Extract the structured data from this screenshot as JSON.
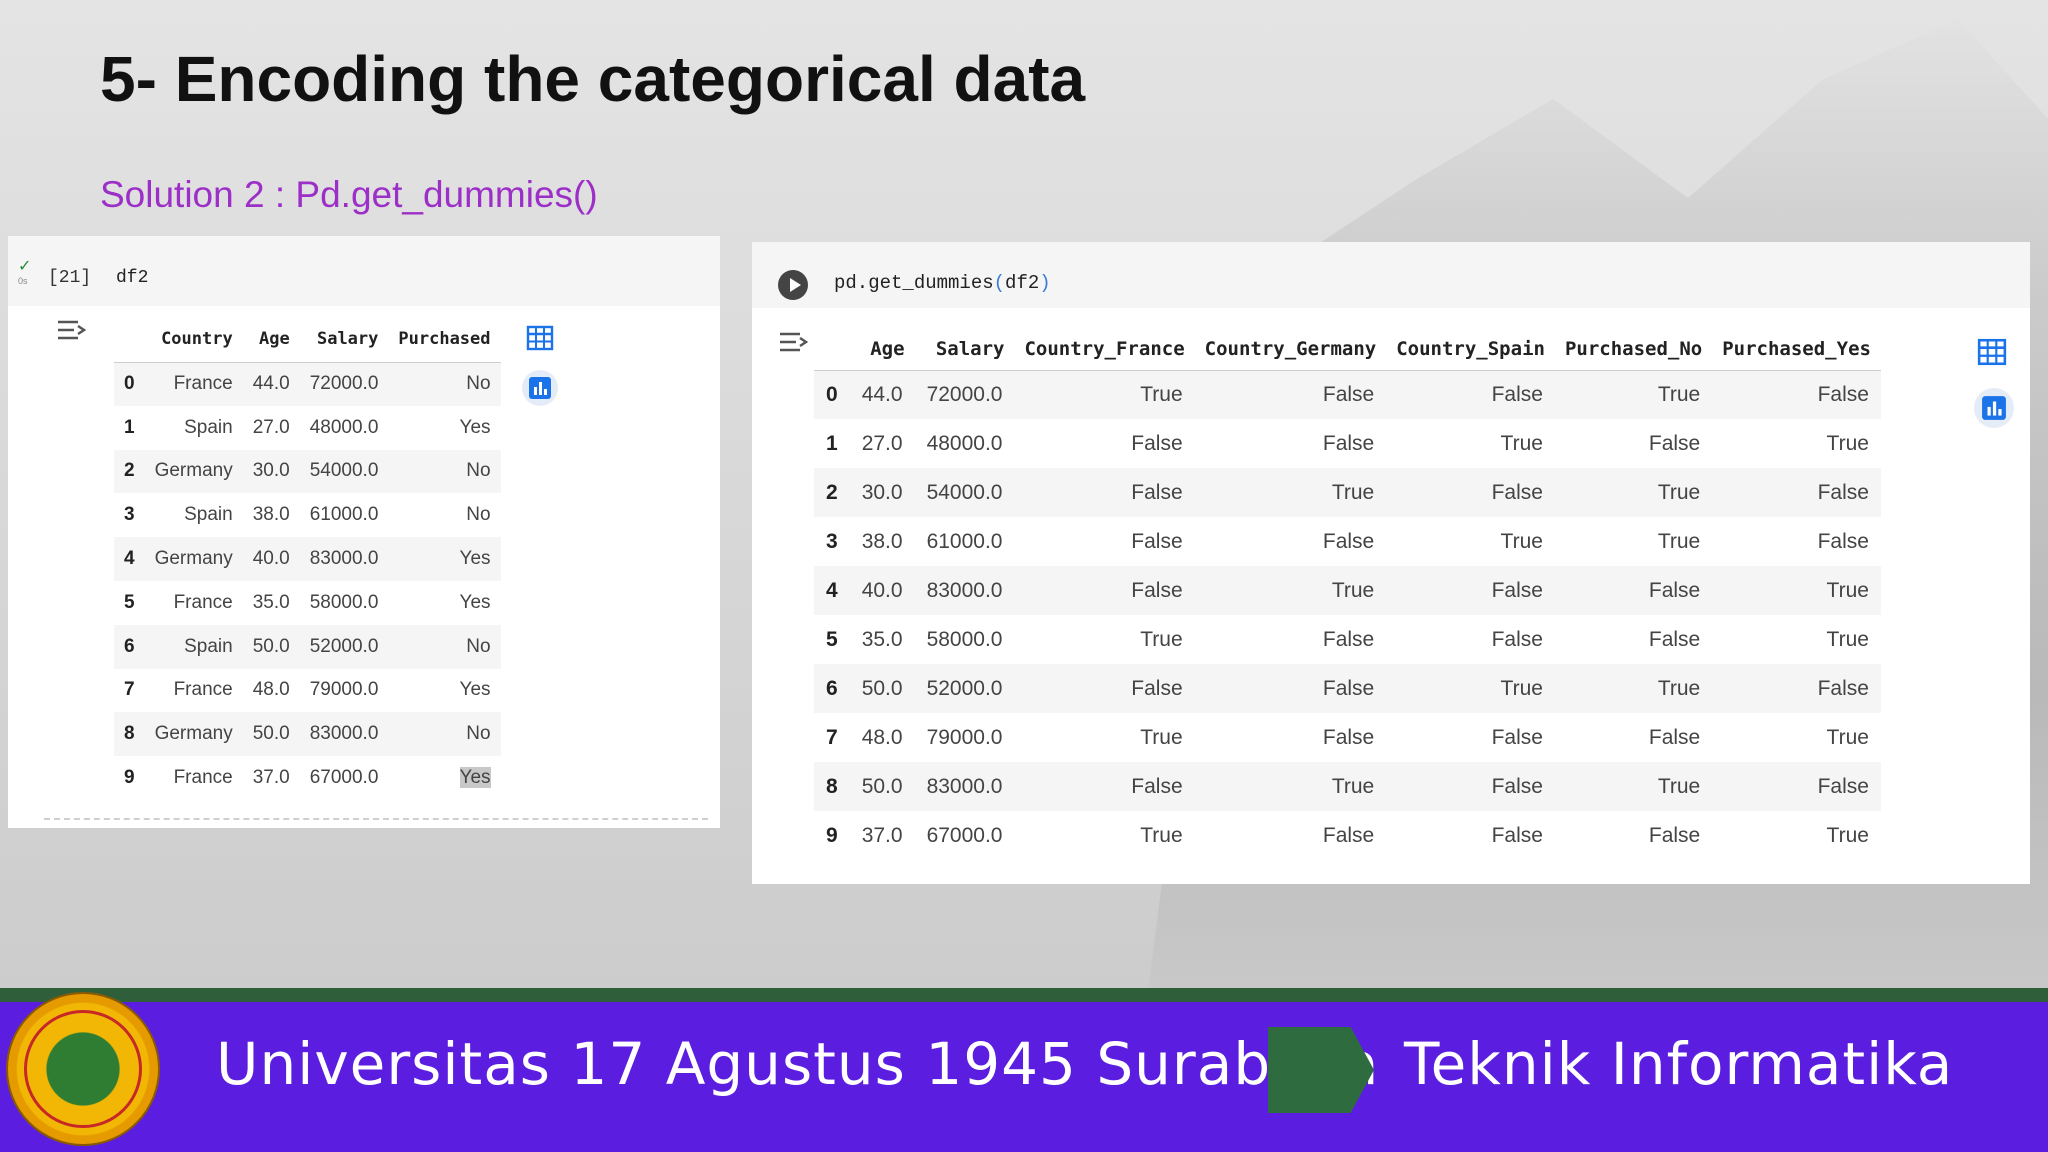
{
  "slide": {
    "title": "5- Encoding the categorical data",
    "subtitle": "Solution 2 : Pd.get_dummies()"
  },
  "left_cell": {
    "exec_status": "✓",
    "exec_time": "0s",
    "exec_count": "[21]",
    "code": "df2",
    "columns": [
      "Country",
      "Age",
      "Salary",
      "Purchased"
    ],
    "rows": [
      {
        "idx": "0",
        "cells": [
          "France",
          "44.0",
          "72000.0",
          "No"
        ]
      },
      {
        "idx": "1",
        "cells": [
          "Spain",
          "27.0",
          "48000.0",
          "Yes"
        ]
      },
      {
        "idx": "2",
        "cells": [
          "Germany",
          "30.0",
          "54000.0",
          "No"
        ]
      },
      {
        "idx": "3",
        "cells": [
          "Spain",
          "38.0",
          "61000.0",
          "No"
        ]
      },
      {
        "idx": "4",
        "cells": [
          "Germany",
          "40.0",
          "83000.0",
          "Yes"
        ]
      },
      {
        "idx": "5",
        "cells": [
          "France",
          "35.0",
          "58000.0",
          "Yes"
        ]
      },
      {
        "idx": "6",
        "cells": [
          "Spain",
          "50.0",
          "52000.0",
          "No"
        ]
      },
      {
        "idx": "7",
        "cells": [
          "France",
          "48.0",
          "79000.0",
          "Yes"
        ]
      },
      {
        "idx": "8",
        "cells": [
          "Germany",
          "50.0",
          "83000.0",
          "No"
        ]
      },
      {
        "idx": "9",
        "cells": [
          "France",
          "37.0",
          "67000.0",
          "Yes"
        ]
      }
    ]
  },
  "right_cell": {
    "code_fn": "pd.get_dummies",
    "code_open": "(",
    "code_arg": "df2",
    "code_close": ")",
    "columns": [
      "Age",
      "Salary",
      "Country_France",
      "Country_Germany",
      "Country_Spain",
      "Purchased_No",
      "Purchased_Yes"
    ],
    "rows": [
      {
        "idx": "0",
        "cells": [
          "44.0",
          "72000.0",
          "True",
          "False",
          "False",
          "True",
          "False"
        ]
      },
      {
        "idx": "1",
        "cells": [
          "27.0",
          "48000.0",
          "False",
          "False",
          "True",
          "False",
          "True"
        ]
      },
      {
        "idx": "2",
        "cells": [
          "30.0",
          "54000.0",
          "False",
          "True",
          "False",
          "True",
          "False"
        ]
      },
      {
        "idx": "3",
        "cells": [
          "38.0",
          "61000.0",
          "False",
          "False",
          "True",
          "True",
          "False"
        ]
      },
      {
        "idx": "4",
        "cells": [
          "40.0",
          "83000.0",
          "False",
          "True",
          "False",
          "False",
          "True"
        ]
      },
      {
        "idx": "5",
        "cells": [
          "35.0",
          "58000.0",
          "True",
          "False",
          "False",
          "False",
          "True"
        ]
      },
      {
        "idx": "6",
        "cells": [
          "50.0",
          "52000.0",
          "False",
          "False",
          "True",
          "True",
          "False"
        ]
      },
      {
        "idx": "7",
        "cells": [
          "48.0",
          "79000.0",
          "True",
          "False",
          "False",
          "False",
          "True"
        ]
      },
      {
        "idx": "8",
        "cells": [
          "50.0",
          "83000.0",
          "False",
          "True",
          "False",
          "True",
          "False"
        ]
      },
      {
        "idx": "9",
        "cells": [
          "37.0",
          "67000.0",
          "True",
          "False",
          "False",
          "False",
          "True"
        ]
      }
    ]
  },
  "footer": {
    "university": "Universitas 17 Agustus 1945 Surabaya",
    "department": "Teknik Informatika"
  },
  "icons": {
    "output_toggle": "output-toggle-icon",
    "table": "table-icon",
    "chart": "chart-icon",
    "run": "run-icon",
    "logo": "university-logo"
  },
  "colors": {
    "subtitle": "#9b2fc7",
    "footer_bg": "#5b1ee0",
    "footer_accent": "#2e6b3f",
    "icon_blue": "#1a73e8"
  }
}
